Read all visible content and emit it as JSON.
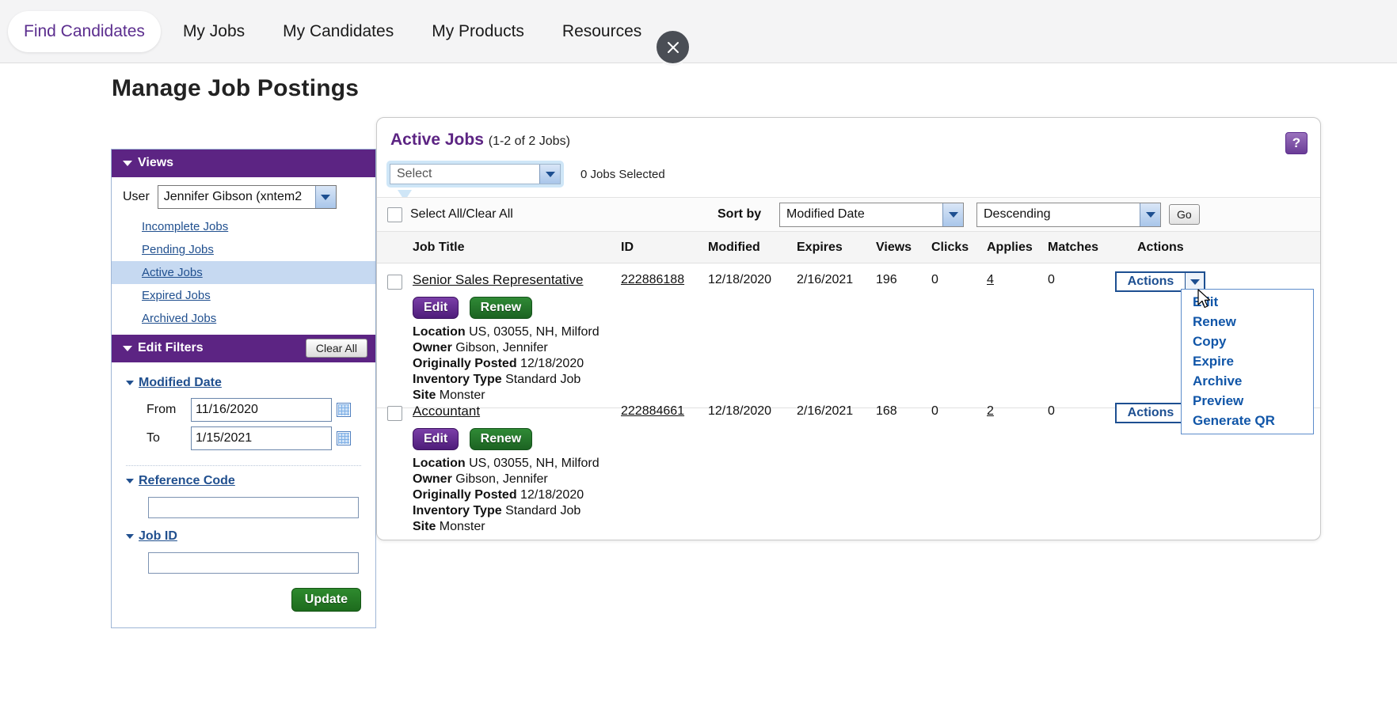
{
  "nav": {
    "items": [
      {
        "label": "Find Candidates",
        "active": true
      },
      {
        "label": "My Jobs",
        "active": false
      },
      {
        "label": "My Candidates",
        "active": false
      },
      {
        "label": "My Products",
        "active": false
      },
      {
        "label": "Resources",
        "active": false
      }
    ],
    "close_icon": "close-icon"
  },
  "page": {
    "title": "Manage Job Postings"
  },
  "sidebar": {
    "views": {
      "header": "Views",
      "user_label": "User",
      "user_value": "Jennifer Gibson (xntem2",
      "links": [
        {
          "label": "Incomplete Jobs",
          "selected": false
        },
        {
          "label": "Pending Jobs",
          "selected": false
        },
        {
          "label": "Active Jobs",
          "selected": true
        },
        {
          "label": "Expired Jobs",
          "selected": false
        },
        {
          "label": "Archived Jobs",
          "selected": false
        }
      ]
    },
    "filters": {
      "header": "Edit Filters",
      "clear_all": "Clear All",
      "modified_date": {
        "title": "Modified Date",
        "from_label": "From",
        "from_value": "11/16/2020",
        "to_label": "To",
        "to_value": "1/15/2021"
      },
      "reference_code": {
        "title": "Reference Code",
        "value": ""
      },
      "job_id": {
        "title": "Job ID",
        "value": ""
      },
      "update": "Update"
    }
  },
  "panel": {
    "title": "Active Jobs",
    "count": "(1-2 of 2 Jobs)",
    "help": "?",
    "bulk_select_value": "Select",
    "jobs_selected": "0 Jobs Selected",
    "select_all_label": "Select All/Clear All",
    "sort_by_label": "Sort by",
    "sort_field": "Modified Date",
    "sort_direction": "Descending",
    "go": "Go",
    "columns": [
      "Job Title",
      "ID",
      "Modified",
      "Expires",
      "Views",
      "Clicks",
      "Applies",
      "Matches",
      "Actions"
    ],
    "rows": [
      {
        "title": "Senior Sales Representative",
        "id": "222886188",
        "modified": "12/18/2020",
        "expires": "2/16/2021",
        "views": "196",
        "clicks": "0",
        "applies": "4",
        "matches": "0",
        "actions_label": "Actions",
        "edit": "Edit",
        "renew": "Renew",
        "meta": [
          {
            "label": "Location",
            "value": "US, 03055, NH, Milford"
          },
          {
            "label": "Owner",
            "value": "Gibson, Jennifer"
          },
          {
            "label": "Originally Posted",
            "value": "12/18/2020"
          },
          {
            "label": "Inventory Type",
            "value": "Standard Job"
          },
          {
            "label": "Site",
            "value": "Monster"
          }
        ]
      },
      {
        "title": "Accountant",
        "id": "222884661",
        "modified": "12/18/2020",
        "expires": "2/16/2021",
        "views": "168",
        "clicks": "0",
        "applies": "2",
        "matches": "0",
        "actions_label": "Actions",
        "edit": "Edit",
        "renew": "Renew",
        "meta": [
          {
            "label": "Location",
            "value": "US, 03055, NH, Milford"
          },
          {
            "label": "Owner",
            "value": "Gibson, Jennifer"
          },
          {
            "label": "Originally Posted",
            "value": "12/18/2020"
          },
          {
            "label": "Inventory Type",
            "value": "Standard Job"
          },
          {
            "label": "Site",
            "value": "Monster"
          }
        ]
      }
    ],
    "actions_menu": [
      "Edit",
      "Renew",
      "Copy",
      "Expire",
      "Archive",
      "Preview",
      "Generate QR"
    ]
  },
  "colors": {
    "brand_purple": "#5c2483",
    "link_blue": "#1f6fb8",
    "menu_blue": "#1156a8",
    "green": "#1d6b1d",
    "selected_row": "#c6d9f1"
  }
}
